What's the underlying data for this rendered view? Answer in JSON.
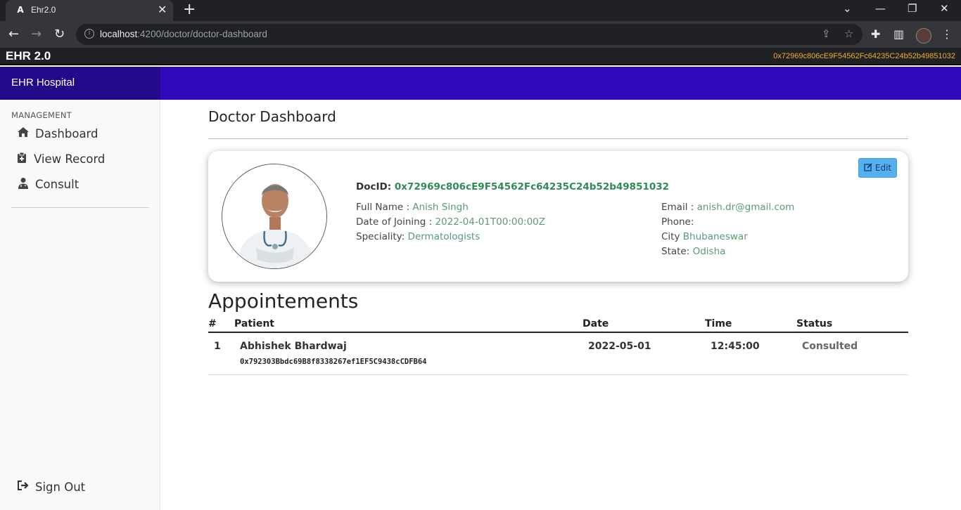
{
  "browser": {
    "tab_title": "Ehr2.0",
    "url_host": "localhost",
    "url_rest": ":4200/doctor/doctor-dashboard"
  },
  "app": {
    "brand": "EHR 2.0",
    "account": "0x72969c806cE9F54562Fc64235C24b52b49851032"
  },
  "header": {
    "hospital": "EHR Hospital"
  },
  "sidebar": {
    "heading": "MANAGEMENT",
    "items": [
      {
        "label": "Dashboard",
        "icon": "home-icon"
      },
      {
        "label": "View Record",
        "icon": "clipboard-icon"
      },
      {
        "label": "Consult",
        "icon": "user-doctor-icon"
      }
    ],
    "signout": "Sign Out"
  },
  "main": {
    "title": "Doctor Dashboard",
    "edit_label": "Edit",
    "docid_label": "DocID:",
    "docid": "0x72969c806cE9F54562Fc64235C24b52b49851032",
    "fields_left": [
      {
        "label": "Full Name :",
        "value": "Anish Singh"
      },
      {
        "label": "Date of Joining :",
        "value": "2022-04-01T00:00:00Z"
      },
      {
        "label": "Speciality:",
        "value": "Dermatologists"
      }
    ],
    "fields_right": [
      {
        "label": "Email :",
        "value": "anish.dr@gmail.com"
      },
      {
        "label": "Phone:",
        "value": ""
      },
      {
        "label": "City",
        "value": "Bhubaneswar"
      },
      {
        "label": "State:",
        "value": "Odisha"
      }
    ]
  },
  "appointments": {
    "title": "Appointements",
    "headers": [
      "#",
      "Patient",
      "Date",
      "Time",
      "Status"
    ],
    "rows": [
      {
        "index": "1",
        "patient": "Abhishek Bhardwaj",
        "address": "0x792303Bbdc69B8f8338267ef1EF5C9438cCDFB64",
        "date": "2022-05-01",
        "time": "12:45:00",
        "status": "Consulted"
      }
    ]
  }
}
